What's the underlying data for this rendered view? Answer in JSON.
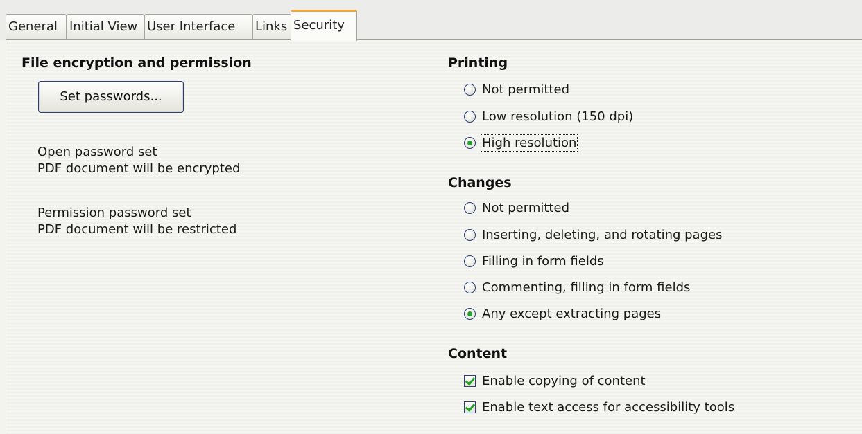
{
  "tabs": {
    "general": "General",
    "initial_view": "Initial View",
    "user_interface": "User Interface",
    "links": "Links",
    "security": "Security",
    "active": "Security"
  },
  "encryption": {
    "heading": "File encryption and permission",
    "set_passwords_label": "Set passwords...",
    "open_status_line1": "Open password set",
    "open_status_line2": "PDF document will be encrypted",
    "perm_status_line1": "Permission password set",
    "perm_status_line2": "PDF document will be restricted"
  },
  "printing": {
    "heading": "Printing",
    "options": [
      "Not permitted",
      "Low resolution (150 dpi)",
      "High resolution"
    ],
    "selected": "High resolution"
  },
  "changes": {
    "heading": "Changes",
    "options": [
      "Not permitted",
      "Inserting, deleting, and rotating pages",
      "Filling in form fields",
      "Commenting, filling in form fields",
      "Any except extracting pages"
    ],
    "selected": "Any except extracting pages"
  },
  "content": {
    "heading": "Content",
    "copy_label": "Enable copying of content",
    "copy_checked": true,
    "access_label": "Enable text access for accessibility tools",
    "access_checked": true
  },
  "colors": {
    "tab_accent": "#f4a636",
    "check_green": "#21a121",
    "control_border": "#2b3f7a"
  }
}
